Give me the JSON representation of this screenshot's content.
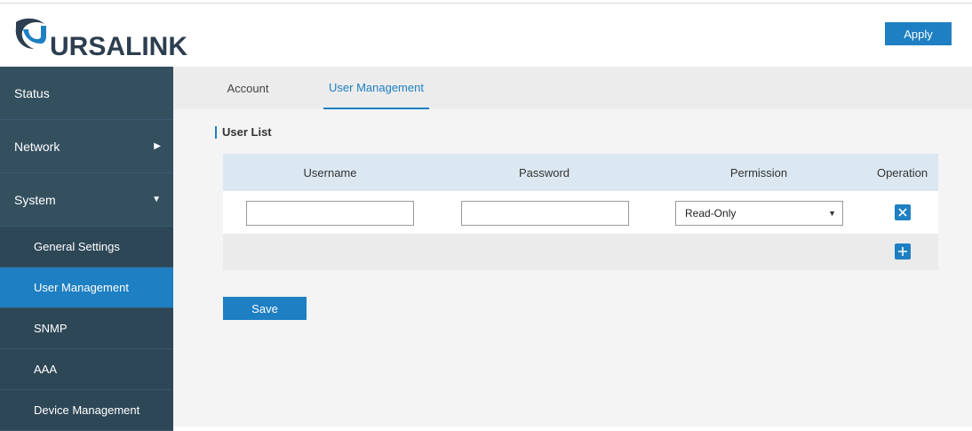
{
  "brand": {
    "logo_text": "URSALINK"
  },
  "header": {
    "apply_label": "Apply"
  },
  "sidebar": {
    "items": [
      {
        "label": "Status"
      },
      {
        "label": "Network"
      },
      {
        "label": "System"
      }
    ],
    "subitems": [
      {
        "label": "General Settings"
      },
      {
        "label": "User Management"
      },
      {
        "label": "SNMP"
      },
      {
        "label": "AAA"
      },
      {
        "label": "Device Management"
      }
    ]
  },
  "tabs": [
    {
      "label": "Account"
    },
    {
      "label": "User Management"
    }
  ],
  "section": {
    "title": "User List"
  },
  "table": {
    "columns": [
      "Username",
      "Password",
      "Permission",
      "Operation"
    ],
    "rows": [
      {
        "username": "",
        "password": "",
        "permission": "Read-Only"
      }
    ]
  },
  "actions": {
    "save_label": "Save"
  },
  "colors": {
    "accent": "#1e7fc2",
    "sidebar": "#2e4a5e"
  }
}
